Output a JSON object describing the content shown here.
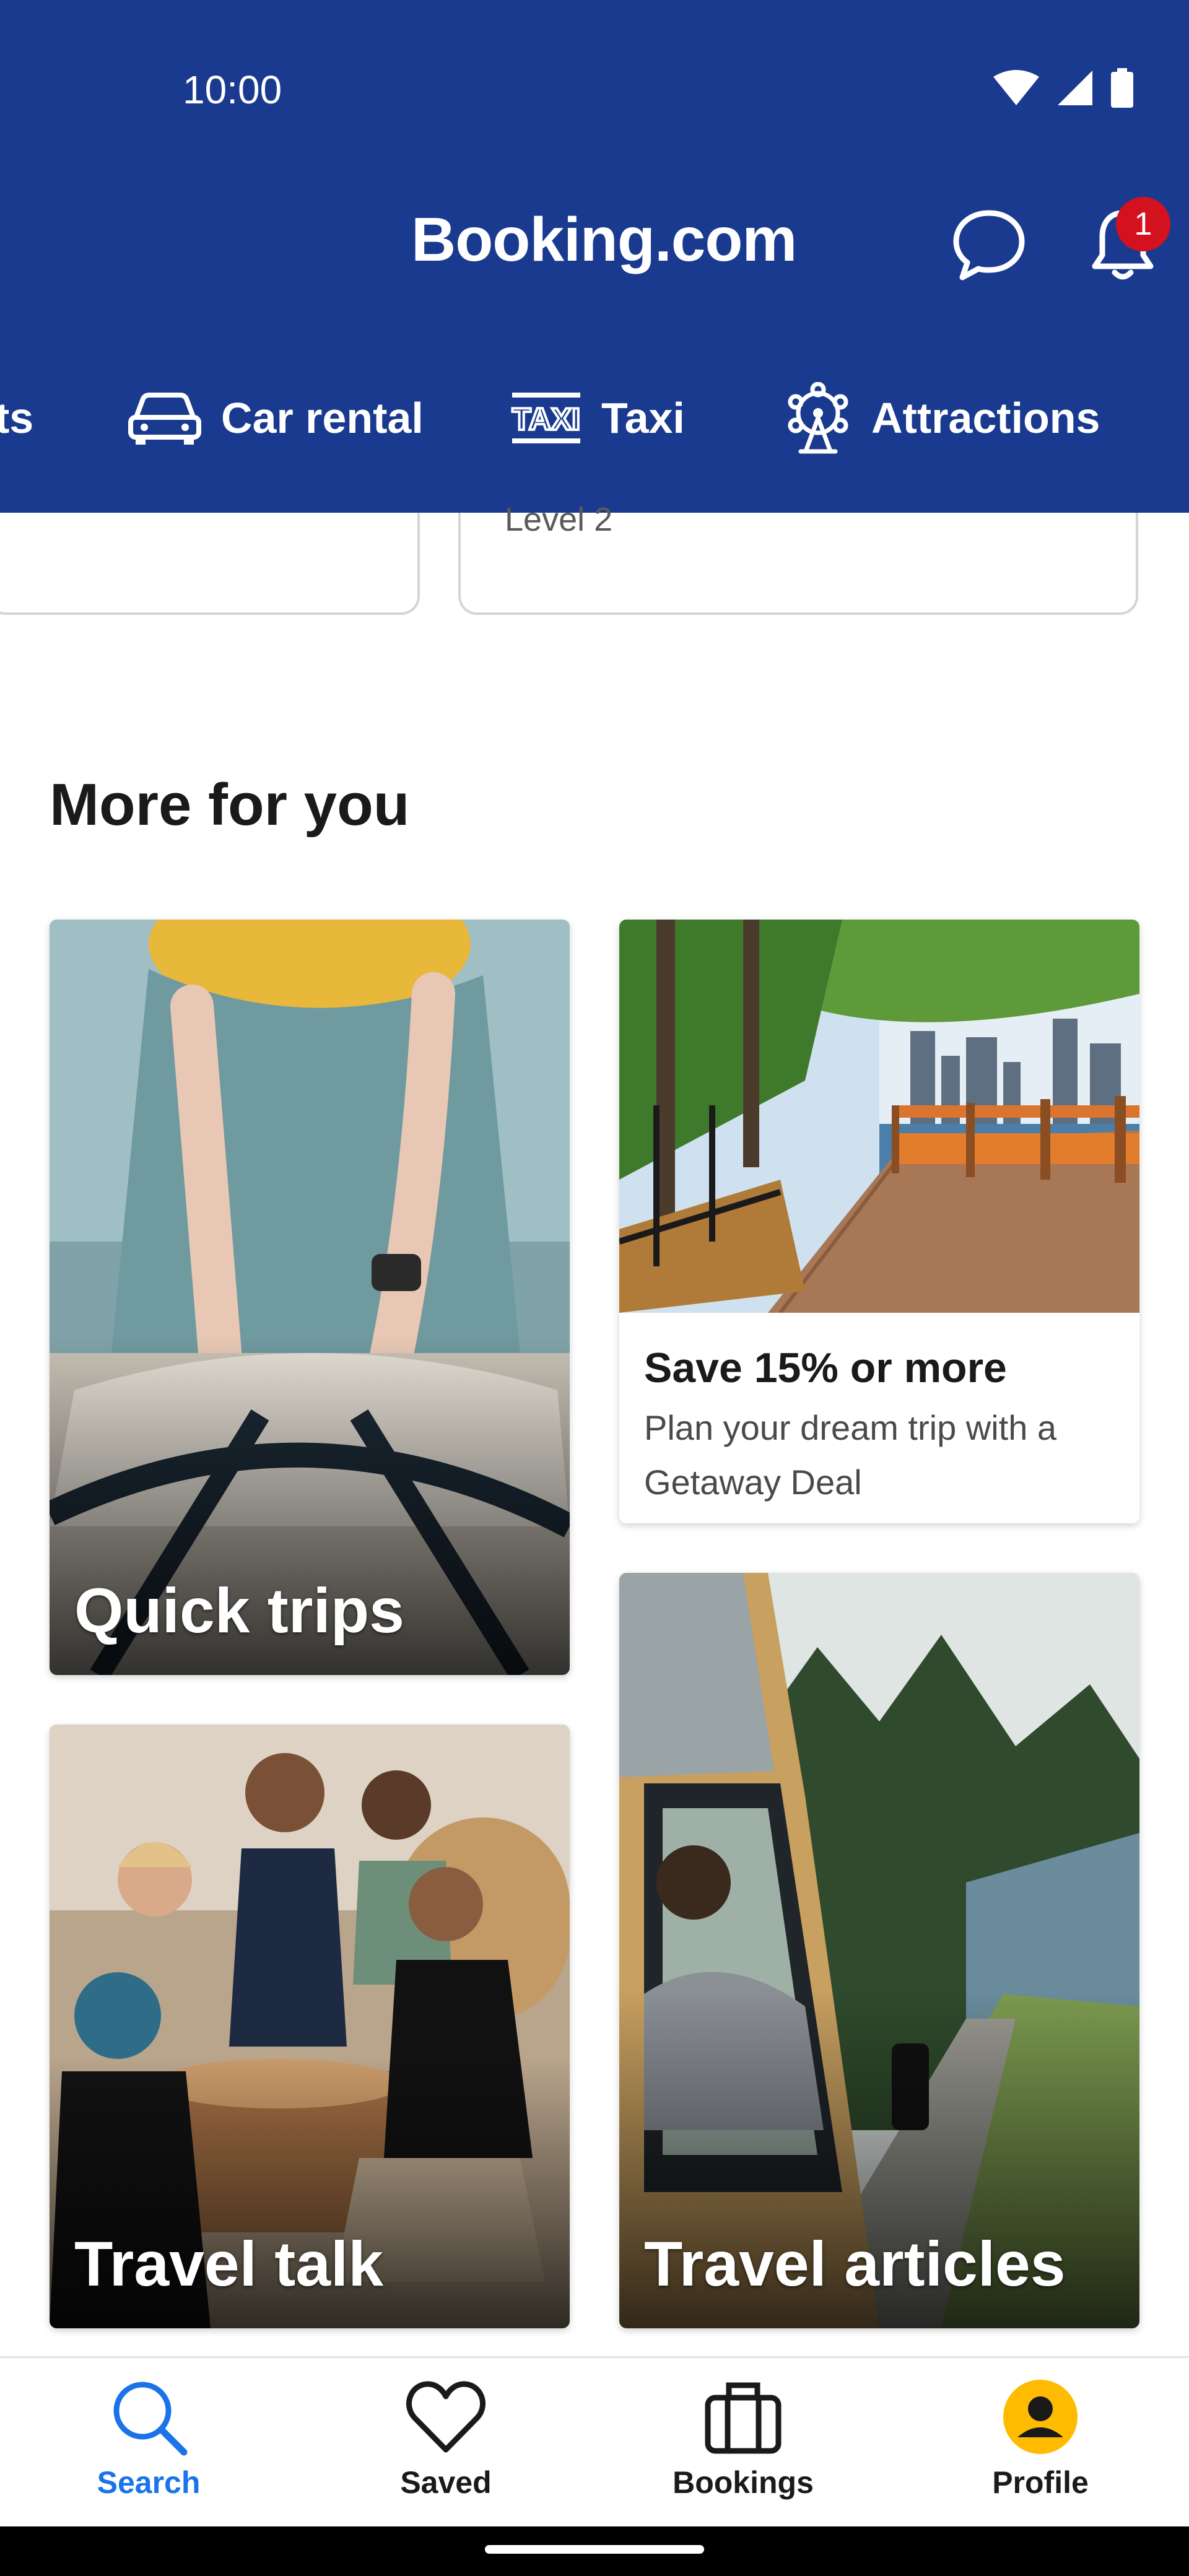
{
  "status_bar": {
    "time": "10:00"
  },
  "header": {
    "brand": "Booking.com",
    "notification_count": "1",
    "nav": [
      {
        "label": "ts",
        "icon": "stays-icon"
      },
      {
        "label": "Car rental",
        "icon": "car-icon"
      },
      {
        "label": "Taxi",
        "icon": "taxi-icon"
      },
      {
        "label": "Attractions",
        "icon": "attractions-icon"
      }
    ]
  },
  "partial_card": {
    "text": "Level 2"
  },
  "section": {
    "title": "More for you",
    "tiles": [
      {
        "caption": "Quick trips"
      },
      {
        "title": "Save 15% or more",
        "text": "Plan your dream trip with a Getaway Deal"
      },
      {
        "caption": "Travel talk"
      },
      {
        "caption": "Travel articles"
      }
    ]
  },
  "bottom_nav": [
    {
      "label": "Search",
      "icon": "search-icon",
      "active": true
    },
    {
      "label": "Saved",
      "icon": "heart-icon"
    },
    {
      "label": "Bookings",
      "icon": "briefcase-icon"
    },
    {
      "label": "Profile",
      "icon": "profile-icon"
    }
  ],
  "colors": {
    "brand_blue": "#1a3a8f",
    "active_blue": "#1a73e8",
    "badge_red": "#d4111e",
    "profile_yellow": "#febb02"
  }
}
